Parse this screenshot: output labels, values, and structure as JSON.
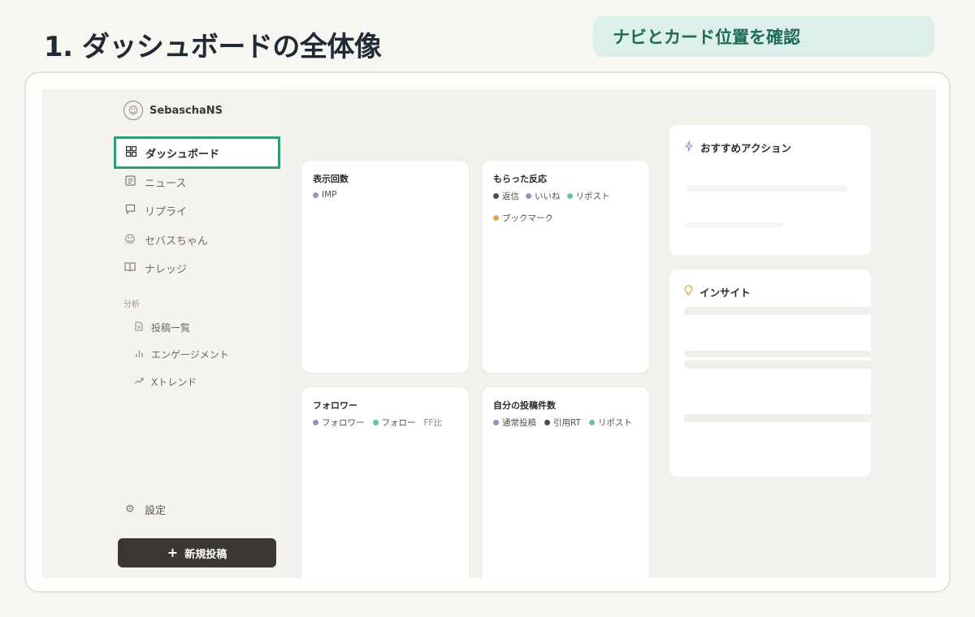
{
  "slide": {
    "title": "1. ダッシュボードの全体像",
    "hint": "ナビとカード位置を確認"
  },
  "sidebar": {
    "brand": "SebaschaNS",
    "brand_icon": "mascot-icon",
    "nav": [
      {
        "label": "ダッシュボード",
        "icon": "grid-icon",
        "active": true
      },
      {
        "label": "ニュース",
        "icon": "newspaper-icon"
      },
      {
        "label": "リプライ",
        "icon": "chat-icon"
      },
      {
        "label": "セバスちゃん",
        "icon": "mascot-icon"
      },
      {
        "label": "ナレッジ",
        "icon": "book-icon"
      }
    ],
    "section_label": "分析",
    "sub_nav": [
      {
        "label": "投稿一覧",
        "icon": "document-icon"
      },
      {
        "label": "エンゲージメント",
        "icon": "bar-chart-icon"
      },
      {
        "label": "Xトレンド",
        "icon": "trend-icon"
      }
    ],
    "settings_label": "設定",
    "new_post_label": "新規投稿",
    "new_post_icon": "plus-icon"
  },
  "cards": {
    "impressions": {
      "title": "表示回数",
      "legend": [
        {
          "label": "IMP",
          "color": "#9b8fc9"
        }
      ]
    },
    "reactions": {
      "title": "もらった反応",
      "legend": [
        {
          "label": "返信",
          "color": "#4a4a4a"
        },
        {
          "label": "いいね",
          "color": "#9b8fc9"
        },
        {
          "label": "リポスト",
          "color": "#6cc19a"
        },
        {
          "label": "ブックマーク",
          "color": "#e0a94b"
        }
      ]
    },
    "followers": {
      "title": "フォロワー",
      "legend": [
        {
          "label": "フォロワー",
          "color": "#9b8fc9"
        },
        {
          "label": "フォロー",
          "color": "#6cc19a"
        }
      ],
      "extra_label": "FF比"
    },
    "posts": {
      "title": "自分の投稿件数",
      "legend": [
        {
          "label": "通常投稿",
          "color": "#9b8fc9"
        },
        {
          "label": "引用RT",
          "color": "#4a4a4a"
        },
        {
          "label": "リポスト",
          "color": "#6cc19a"
        }
      ]
    }
  },
  "right": {
    "actions": {
      "title": "おすすめアクション",
      "icon": "lightning-icon"
    },
    "insights": {
      "title": "インサイト",
      "icon": "lightbulb-icon"
    }
  },
  "colors": {
    "accent": "#2f9e72",
    "hint_bg": "#dcefea",
    "button_bg": "#3b3833"
  }
}
